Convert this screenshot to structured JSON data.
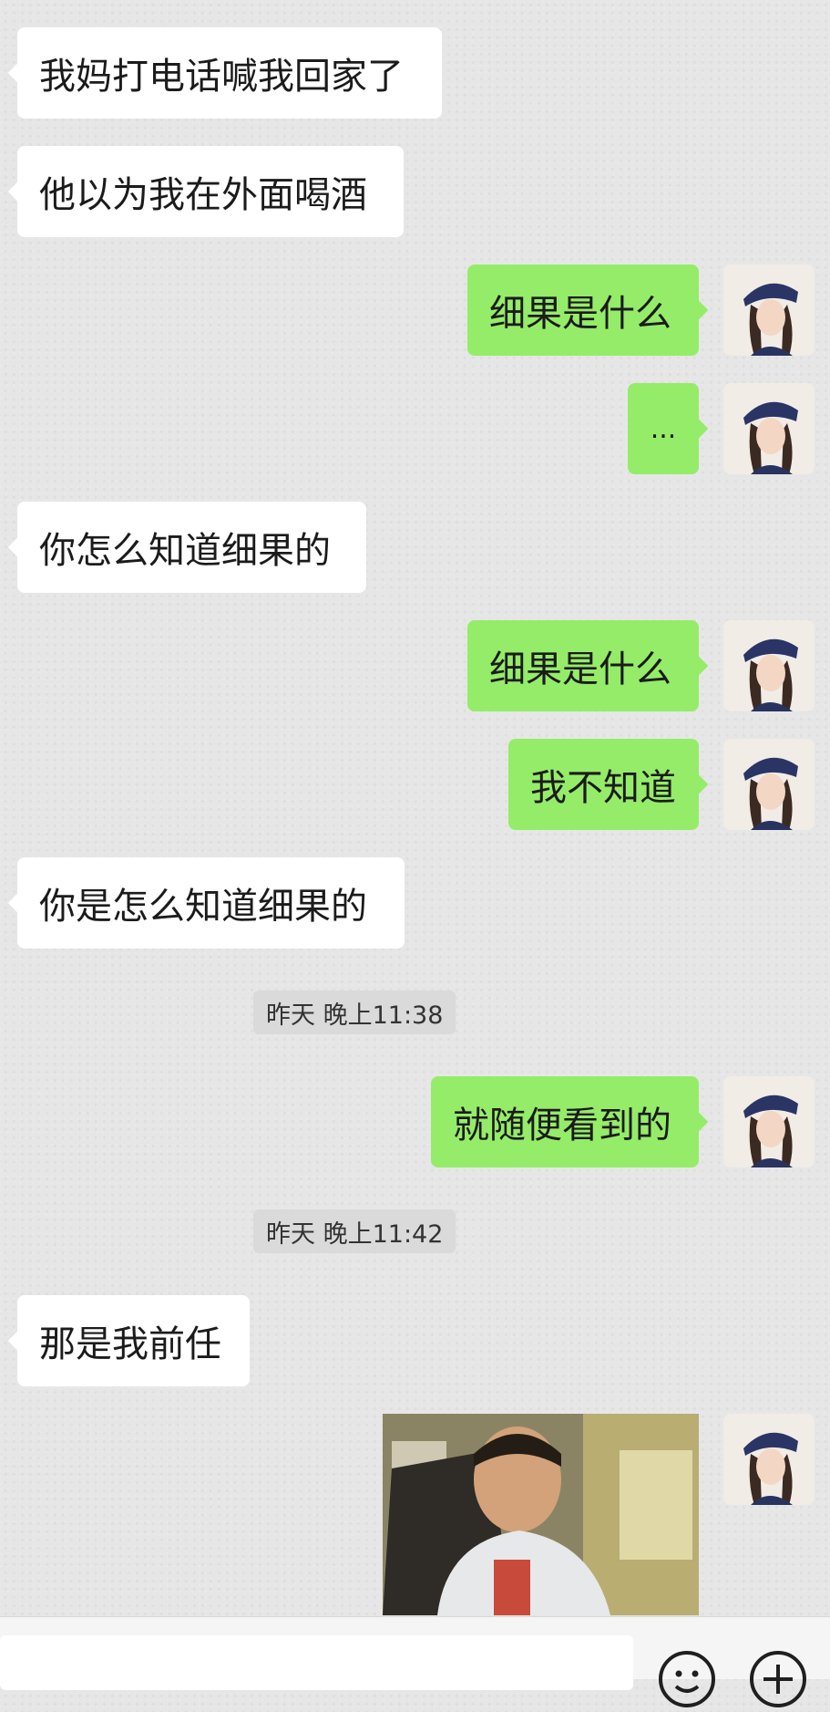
{
  "chat": {
    "messages": [
      {
        "side": "left",
        "text": "我妈打电话喊我回家了"
      },
      {
        "side": "left",
        "text": "他以为我在外面喝酒"
      },
      {
        "side": "right",
        "text": "细果是什么"
      },
      {
        "side": "right",
        "text": "..."
      },
      {
        "side": "left",
        "text": "你怎么知道细果的"
      },
      {
        "side": "right",
        "text": "细果是什么"
      },
      {
        "side": "right",
        "text": "我不知道"
      },
      {
        "side": "left",
        "text": "你是怎么知道细果的"
      },
      {
        "side": "time",
        "text": "昨天 晚上11:38"
      },
      {
        "side": "right",
        "text": "就随便看到的"
      },
      {
        "side": "time",
        "text": "昨天 晚上11:42"
      },
      {
        "side": "left",
        "text": "那是我前任"
      },
      {
        "side": "right",
        "type": "image",
        "description": "meme photo"
      }
    ]
  },
  "colors": {
    "background": "#e6e6e6",
    "bubble_left": "#ffffff",
    "bubble_right": "#95ec69",
    "timestamp_bg": "#dadada"
  },
  "input_bar": {
    "icons": [
      "emoji-icon",
      "plus-icon"
    ]
  }
}
